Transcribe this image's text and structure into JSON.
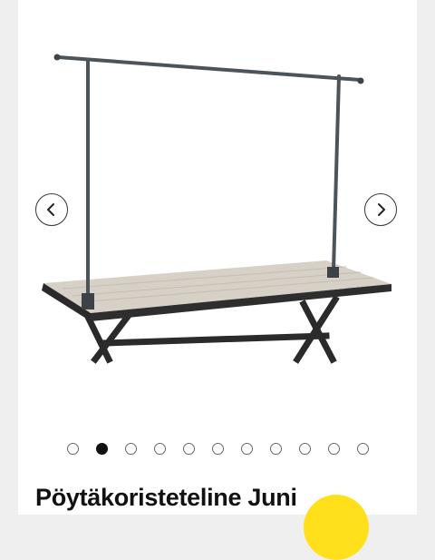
{
  "product": {
    "title": "Pöytäkoristeteline Juni",
    "badge_color": "#ffe01a"
  },
  "gallery": {
    "image_count": 11,
    "active_index": 1,
    "prev_icon": "chevron-left-icon",
    "next_icon": "chevron-right-icon"
  }
}
